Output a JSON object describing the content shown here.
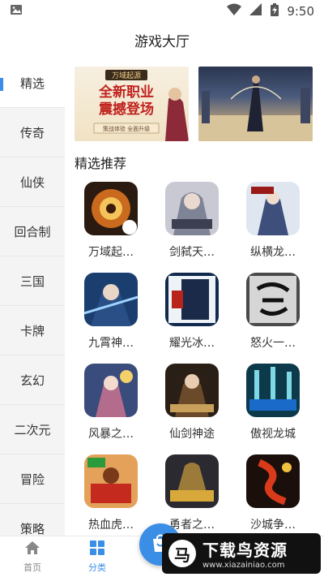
{
  "status_bar": {
    "time": "9:50"
  },
  "header": {
    "title": "游戏大厅"
  },
  "sidebar": {
    "items": [
      {
        "label": "精选"
      },
      {
        "label": "传奇"
      },
      {
        "label": "仙侠"
      },
      {
        "label": "回合制"
      },
      {
        "label": "三国"
      },
      {
        "label": "卡牌"
      },
      {
        "label": "玄幻"
      },
      {
        "label": "二次元"
      },
      {
        "label": "冒险"
      },
      {
        "label": "策略"
      }
    ]
  },
  "banners": {
    "b1": {
      "brand": "万域起源",
      "line1": "全新职业",
      "line2": "震撼登场",
      "sub": "策战体验 全面升级"
    }
  },
  "section": {
    "title": "精选推荐"
  },
  "games": [
    {
      "name": "万域起…"
    },
    {
      "name": "剑弑天…"
    },
    {
      "name": "纵横龙…"
    },
    {
      "name": "九霄神…"
    },
    {
      "name": "耀光冰…"
    },
    {
      "name": "怒火一…"
    },
    {
      "name": "风暴之…"
    },
    {
      "name": "仙剑神途"
    },
    {
      "name": "傲视龙城"
    },
    {
      "name": "热血虎…"
    },
    {
      "name": "勇者之…"
    },
    {
      "name": "沙城争…"
    }
  ],
  "nav": {
    "home": "首页",
    "category": "分类"
  },
  "watermark": {
    "logo": "马",
    "title": "下载鸟资源",
    "url": "www.xiazainiao.com"
  },
  "colors": {
    "accent": "#3a8ee6"
  }
}
